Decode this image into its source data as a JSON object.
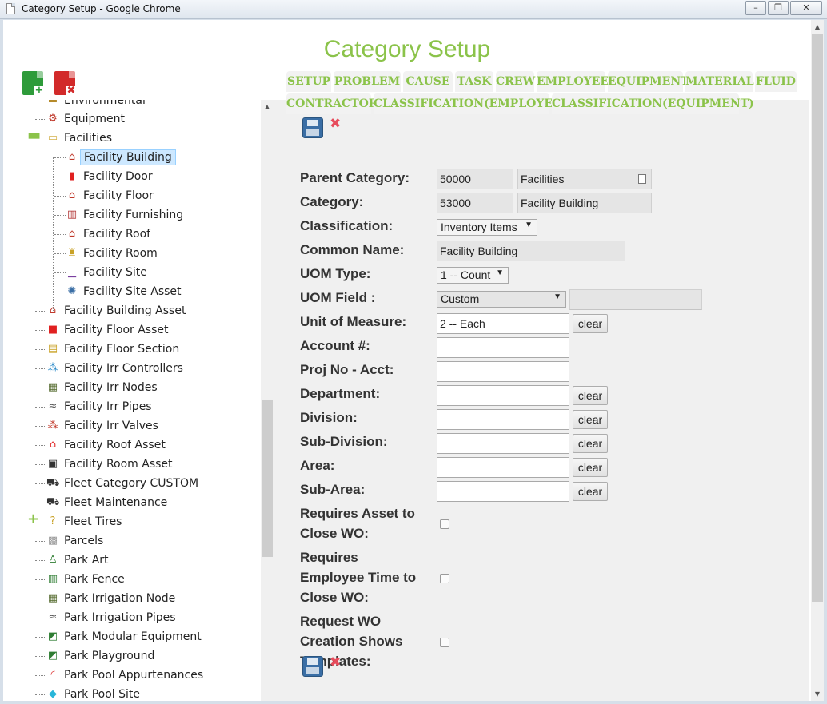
{
  "window": {
    "title": "Category Setup - Google Chrome",
    "minimize": "–",
    "maximize": "❐",
    "close": "✕"
  },
  "page": {
    "title": "Category Setup"
  },
  "toolbar": {
    "add_glyph": "+",
    "delete_glyph": "✖"
  },
  "tree": {
    "items": [
      {
        "label": "Environmental",
        "icon": "tree-icon",
        "glyph": "▬",
        "color": "#b58a2a"
      },
      {
        "label": "Equipment",
        "icon": "equipment-icon",
        "glyph": "⚙",
        "color": "#c0392b"
      },
      {
        "label": "Facilities",
        "icon": "folder-icon",
        "glyph": "▭",
        "color": "#d4b24c"
      },
      {
        "label": "Facility Building",
        "icon": "building-icon",
        "glyph": "⌂",
        "color": "#c0392b"
      },
      {
        "label": "Facility Door",
        "icon": "door-icon",
        "glyph": "▮",
        "color": "#e02020"
      },
      {
        "label": "Facility Floor",
        "icon": "floor-icon",
        "glyph": "⌂",
        "color": "#c0392b"
      },
      {
        "label": "Facility Furnishing",
        "icon": "furnishing-icon",
        "glyph": "▥",
        "color": "#b03030"
      },
      {
        "label": "Facility Roof",
        "icon": "roof-icon",
        "glyph": "⌂",
        "color": "#c0392b"
      },
      {
        "label": "Facility Room",
        "icon": "room-icon",
        "glyph": "♜",
        "color": "#c9a227"
      },
      {
        "label": "Facility Site",
        "icon": "site-icon",
        "glyph": "▁",
        "color": "#7a3fa0"
      },
      {
        "label": "Facility Site Asset",
        "icon": "site-asset-icon",
        "glyph": "✺",
        "color": "#3a6ea5"
      },
      {
        "label": "Facility Building Asset",
        "icon": "building-asset-icon",
        "glyph": "⌂",
        "color": "#c0392b"
      },
      {
        "label": "Facility Floor Asset",
        "icon": "floor-asset-icon",
        "glyph": "■",
        "color": "#e02020"
      },
      {
        "label": "Facility Floor Section",
        "icon": "floor-section-icon",
        "glyph": "▤",
        "color": "#c9a227"
      },
      {
        "label": "Facility Irr Controllers",
        "icon": "irr-controller-icon",
        "glyph": "⁂",
        "color": "#2a8ac9"
      },
      {
        "label": "Facility Irr Nodes",
        "icon": "irr-node-icon",
        "glyph": "▦",
        "color": "#556b2f"
      },
      {
        "label": "Facility Irr Pipes",
        "icon": "irr-pipe-icon",
        "glyph": "≈",
        "color": "#555"
      },
      {
        "label": "Facility Irr Valves",
        "icon": "irr-valve-icon",
        "glyph": "⁂",
        "color": "#c0392b"
      },
      {
        "label": "Facility Roof Asset",
        "icon": "roof-asset-icon",
        "glyph": "⌂",
        "color": "#e02020"
      },
      {
        "label": "Facility Room Asset",
        "icon": "room-asset-icon",
        "glyph": "▣",
        "color": "#333"
      },
      {
        "label": "Fleet Category CUSTOM",
        "icon": "truck-icon",
        "glyph": "⛟",
        "color": "#333"
      },
      {
        "label": "Fleet Maintenance",
        "icon": "truck-icon",
        "glyph": "⛟",
        "color": "#333"
      },
      {
        "label": "Fleet Tires",
        "icon": "question-icon",
        "glyph": "?",
        "color": "#c9a227"
      },
      {
        "label": "Parcels",
        "icon": "parcel-icon",
        "glyph": "▩",
        "color": "#999"
      },
      {
        "label": "Park Art",
        "icon": "art-icon",
        "glyph": "♙",
        "color": "#2e7d32"
      },
      {
        "label": "Park Fence",
        "icon": "fence-icon",
        "glyph": "▥",
        "color": "#2e7d32"
      },
      {
        "label": "Park Irrigation Node",
        "icon": "irrigation-node-icon",
        "glyph": "▦",
        "color": "#556b2f"
      },
      {
        "label": "Park Irrigation Pipes",
        "icon": "irrigation-pipe-icon",
        "glyph": "≈",
        "color": "#555"
      },
      {
        "label": "Park Modular Equipment",
        "icon": "modular-equipment-icon",
        "glyph": "◩",
        "color": "#2e7d32"
      },
      {
        "label": "Park Playground",
        "icon": "playground-icon",
        "glyph": "◩",
        "color": "#2e7d32"
      },
      {
        "label": "Park Pool Appurtenances",
        "icon": "pool-appurtenance-icon",
        "glyph": "◜",
        "color": "#d33"
      },
      {
        "label": "Park Pool Site",
        "icon": "pool-site-icon",
        "glyph": "◆",
        "color": "#29b6d9"
      }
    ]
  },
  "tabs": [
    {
      "label": "SETUP"
    },
    {
      "label": "PROBLEM"
    },
    {
      "label": "CAUSE"
    },
    {
      "label": "TASK"
    },
    {
      "label": "CREW"
    },
    {
      "label": "EMPLOYEE"
    },
    {
      "label": "EQUIPMENT"
    },
    {
      "label": "MATERIAL"
    },
    {
      "label": "FLUID"
    },
    {
      "label": "CONTRACTOR"
    },
    {
      "label": "CLASSIFICATION(EMPLOYEE)"
    },
    {
      "label": "CLASSIFICATION(EQUIPMENT)"
    }
  ],
  "form": {
    "parent_category": {
      "label": "Parent Category:",
      "code": "50000",
      "name": "Facilities"
    },
    "category": {
      "label": "Category:",
      "code": "53000",
      "name": "Facility Building"
    },
    "classification": {
      "label": "Classification:",
      "value": "Inventory Items"
    },
    "common_name": {
      "label": "Common Name:",
      "value": "Facility Building"
    },
    "uom_type": {
      "label": "UOM Type:",
      "value": "1 -- Count"
    },
    "uom_field": {
      "label": "UOM Field :",
      "value": "Custom",
      "extra": ""
    },
    "unit_of_measure": {
      "label": "Unit of Measure:",
      "value": "2 -- Each"
    },
    "account": {
      "label": "Account #:",
      "value": ""
    },
    "proj_no": {
      "label": "Proj No - Acct:",
      "value": ""
    },
    "department": {
      "label": "Department:",
      "value": ""
    },
    "division": {
      "label": "Division:",
      "value": ""
    },
    "sub_division": {
      "label": "Sub-Division:",
      "value": ""
    },
    "area": {
      "label": "Area:",
      "value": ""
    },
    "sub_area": {
      "label": "Sub-Area:",
      "value": ""
    },
    "req_asset": {
      "line1": "Requires Asset to",
      "line2": "Close WO:"
    },
    "req_emp_time": {
      "line1": "Requires",
      "line2": "Employee Time to",
      "line3": "Close WO:"
    },
    "req_templates": {
      "line1": "Request WO",
      "line2": "Creation Shows",
      "line3": "Templates:"
    },
    "clear_label": "clear",
    "dropdown_arrow": "▼",
    "delete_glyph": "✖"
  },
  "colors": {
    "accent": "#8bc34a",
    "selected_bg": "#cde8ff"
  }
}
